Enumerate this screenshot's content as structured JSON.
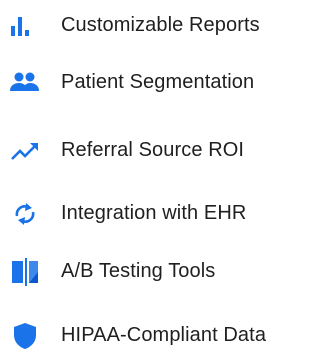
{
  "features": {
    "items": [
      {
        "icon": "bar-chart-icon",
        "label": "Customizable Reports"
      },
      {
        "icon": "people-icon",
        "label": "Patient Segmentation"
      },
      {
        "icon": "trending-up-icon",
        "label": "Referral Source ROI"
      },
      {
        "icon": "sync-icon",
        "label": "Integration with EHR"
      },
      {
        "icon": "compare-icon",
        "label": "A/B Testing Tools"
      },
      {
        "icon": "shield-icon",
        "label": "HIPAA-Compliant Data"
      }
    ]
  },
  "colors": {
    "icon_blue": "#1a73e8",
    "text": "#1f1f1f",
    "background": "#ffffff"
  }
}
